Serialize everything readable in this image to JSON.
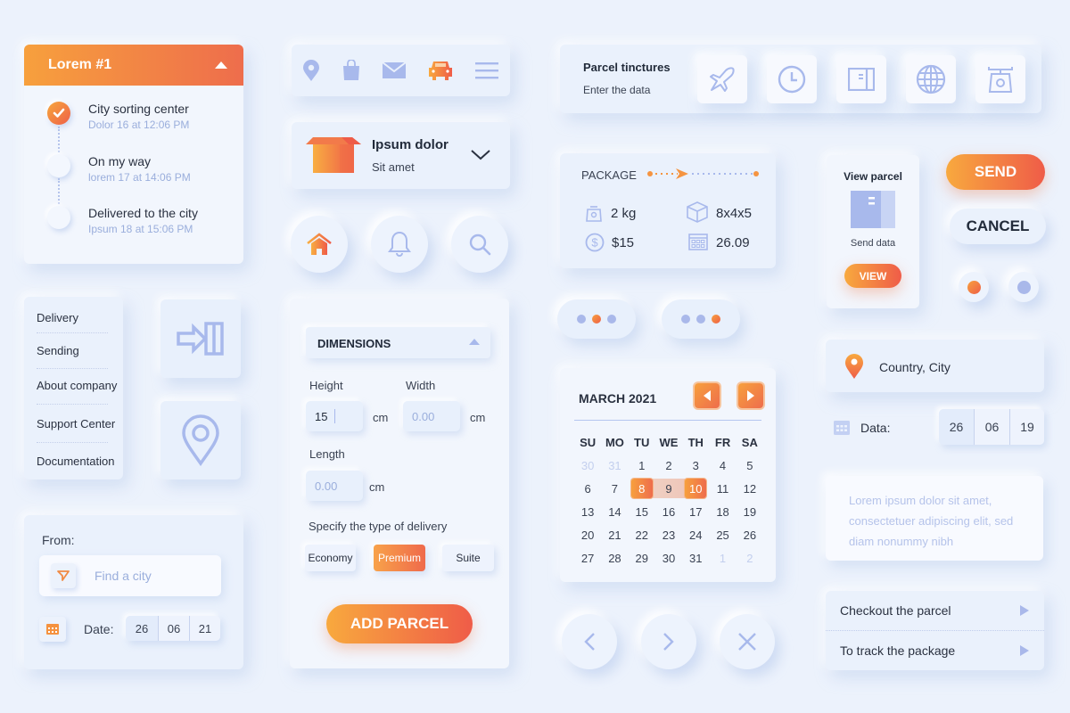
{
  "colors": {
    "background": "#ecf2fc",
    "accent_start": "#f8a93e",
    "accent_end": "#ef5c48",
    "icon_blue": "#a8b9ec",
    "muted_text": "#9aaedc"
  },
  "tracking": {
    "title": "Lorem #1",
    "toggle_icon": "triangle-up-icon",
    "steps": [
      {
        "title": "City sorting center",
        "time": "Dolor 16 at 12:06 PM",
        "done": true
      },
      {
        "title": "On my way",
        "time": "lorem 17 at 14:06 PM",
        "done": false
      },
      {
        "title": "Delivered to the city",
        "time": "Ipsum 18 at 15:06 PM",
        "done": false
      }
    ]
  },
  "icon_bar": {
    "icons": [
      "location-pin-icon",
      "shopping-bag-icon",
      "mail-icon",
      "car-icon",
      "hamburger-menu-icon"
    ],
    "active": "car-icon"
  },
  "parcel_select": {
    "title": "Ipsum dolor",
    "subtitle": "Sit amet",
    "icon": "box-icon",
    "chevron": "chevron-down-icon"
  },
  "round_icons": [
    "home-icon",
    "bell-icon",
    "search-icon"
  ],
  "nav_menu": {
    "items": [
      "Delivery",
      "Sending",
      "About company",
      "Support Center",
      "Documentation"
    ]
  },
  "tiles": [
    "login-icon",
    "location-pin-icon"
  ],
  "from_form": {
    "label": "From:",
    "search_placeholder": "Find a city",
    "date_label": "Date:",
    "date": {
      "day": "26",
      "month": "06",
      "year": "21"
    }
  },
  "dimensions": {
    "header": "DIMENSIONS",
    "height_label": "Height",
    "height_value": "15",
    "width_label": "Width",
    "width_placeholder": "0.00",
    "length_label": "Length",
    "length_placeholder": "0.00",
    "unit": "cm",
    "delivery_label": "Specify the type of delivery",
    "delivery_options": [
      "Economy",
      "Premium",
      "Suite"
    ],
    "delivery_selected": "Premium",
    "add_button": "ADD PARCEL"
  },
  "parcel_tinctures": {
    "title": "Parcel tinctures",
    "subtitle": "Enter the data",
    "icons": [
      "airplane-icon",
      "clock-icon",
      "book-icon",
      "globe-icon",
      "scale-icon"
    ]
  },
  "package": {
    "title": "PACKAGE",
    "weight": "2 kg",
    "size": "8x4x5",
    "price": "$15",
    "date": "26.09"
  },
  "pagers": [
    {
      "count": 3,
      "active_index": 1
    },
    {
      "count": 3,
      "active_index": 2
    }
  ],
  "calendar": {
    "title": "MARCH 2021",
    "weekdays": [
      "SU",
      "MO",
      "TU",
      "WE",
      "TH",
      "FR",
      "SA"
    ],
    "weeks": [
      [
        "30",
        "31",
        "1",
        "2",
        "3",
        "4",
        "5"
      ],
      [
        "6",
        "7",
        "8",
        "9",
        "10",
        "11",
        "12"
      ],
      [
        "13",
        "14",
        "15",
        "16",
        "17",
        "18",
        "19"
      ],
      [
        "20",
        "21",
        "22",
        "23",
        "24",
        "25",
        "26"
      ],
      [
        "27",
        "28",
        "29",
        "30",
        "31",
        "1",
        "2"
      ]
    ],
    "muted": [
      [
        0,
        0
      ],
      [
        0,
        1
      ],
      [
        4,
        5
      ],
      [
        4,
        6
      ]
    ],
    "range_start": "8",
    "range_end": "10"
  },
  "nav_round": [
    "chevron-left-icon",
    "chevron-right-icon",
    "close-icon"
  ],
  "view_parcel": {
    "title": "View parcel",
    "subtitle": "Send data",
    "button": "VIEW"
  },
  "actions": {
    "send": "SEND",
    "cancel": "CANCEL"
  },
  "radios": [
    {
      "color": "orange",
      "selected": true
    },
    {
      "color": "blue",
      "selected": false
    }
  ],
  "location": {
    "text": "Country, City"
  },
  "data_date": {
    "label": "Data:",
    "day": "26",
    "month": "06",
    "year": "19"
  },
  "textarea": {
    "placeholder": "Lorem ipsum dolor sit amet, consectetuer adipiscing elit, sed diam nonummy nibh"
  },
  "links": [
    "Checkout the parcel",
    "To track the package"
  ]
}
